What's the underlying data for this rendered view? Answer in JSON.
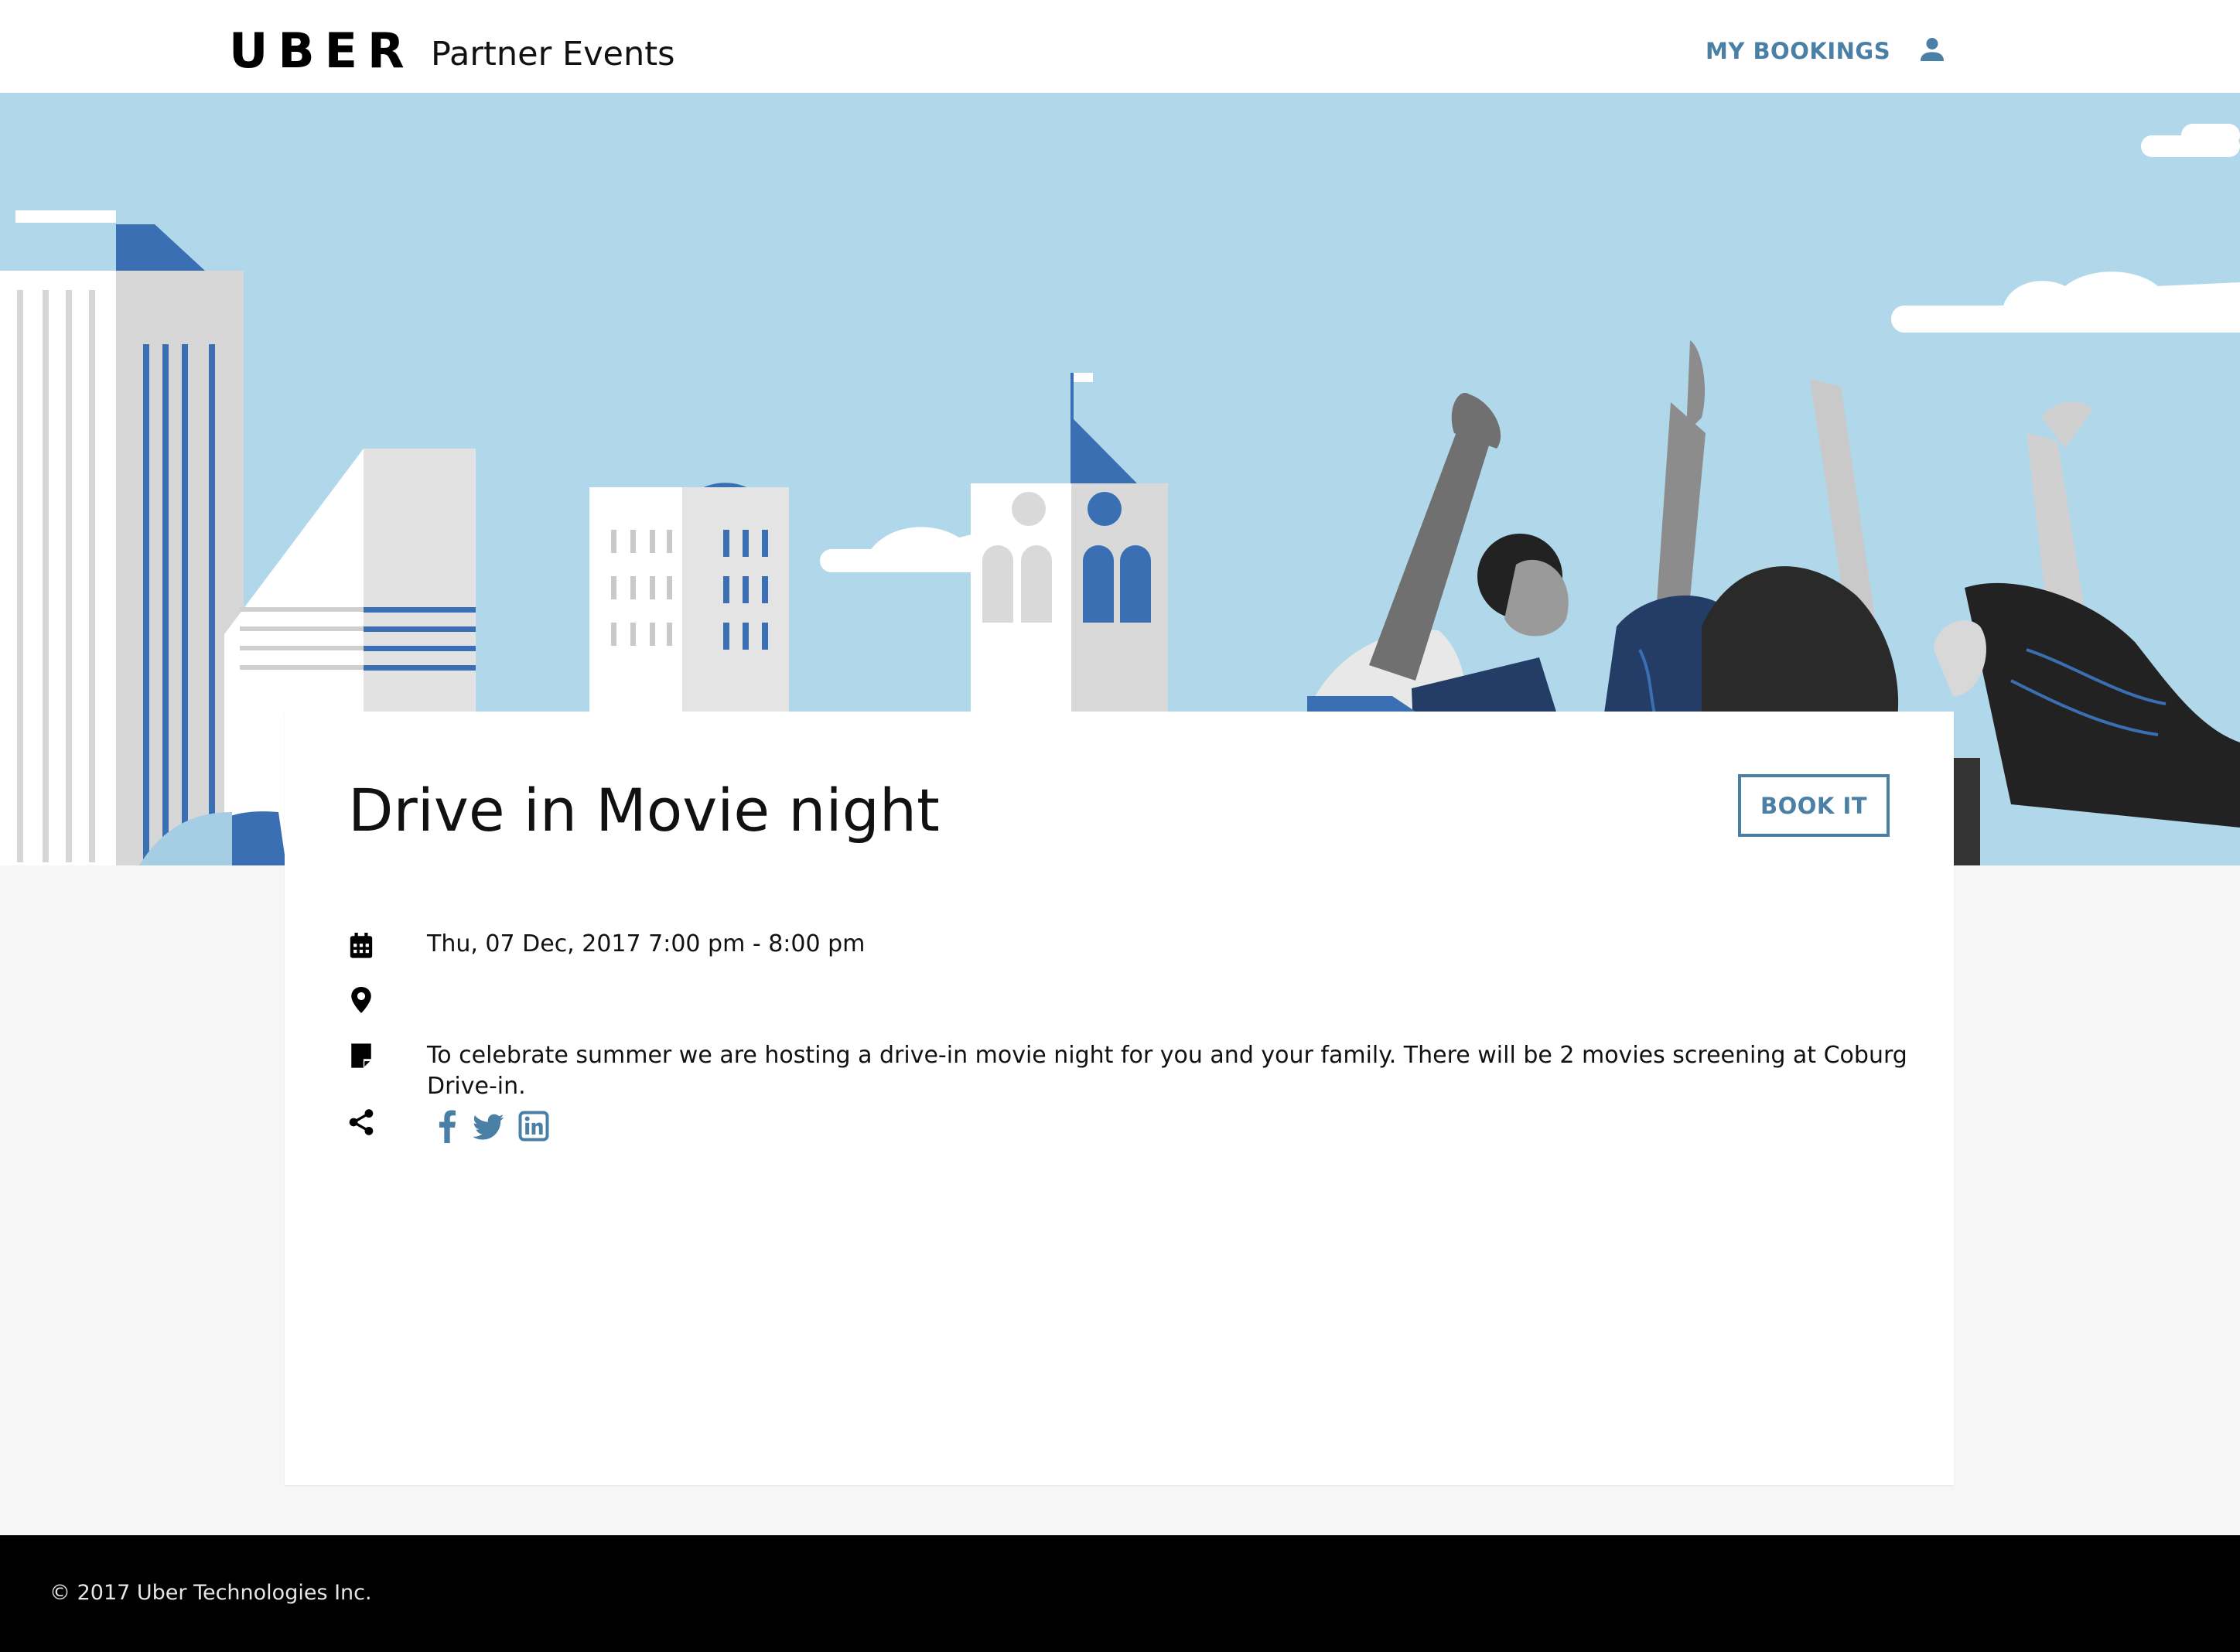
{
  "header": {
    "logo_text": "UBER",
    "subtitle": "Partner Events",
    "nav_bookings_label": "MY BOOKINGS",
    "user_icon": "person-icon"
  },
  "event": {
    "title": "Drive in Movie night",
    "book_label": "BOOK IT",
    "datetime": "Thu, 07 Dec, 2017 7:00 pm - 8:00 pm",
    "location": "",
    "description": "To celebrate summer we are hosting a drive-in movie night for you and your family. There will be 2 movies screening at Coburg Drive-in.",
    "icons": {
      "datetime": "calendar-icon",
      "location": "location-pin-icon",
      "description": "note-icon",
      "share": "share-icon"
    },
    "social": [
      "facebook-icon",
      "twitter-icon",
      "linkedin-icon"
    ]
  },
  "footer": {
    "copyright": "© 2017 Uber Technologies Inc."
  },
  "colors": {
    "accent": "#4a7fa6",
    "sky": "#b1d8ea",
    "building_blue": "#3a6fb3",
    "footer_bg": "#000000",
    "page_bg": "#f6f6f6"
  }
}
